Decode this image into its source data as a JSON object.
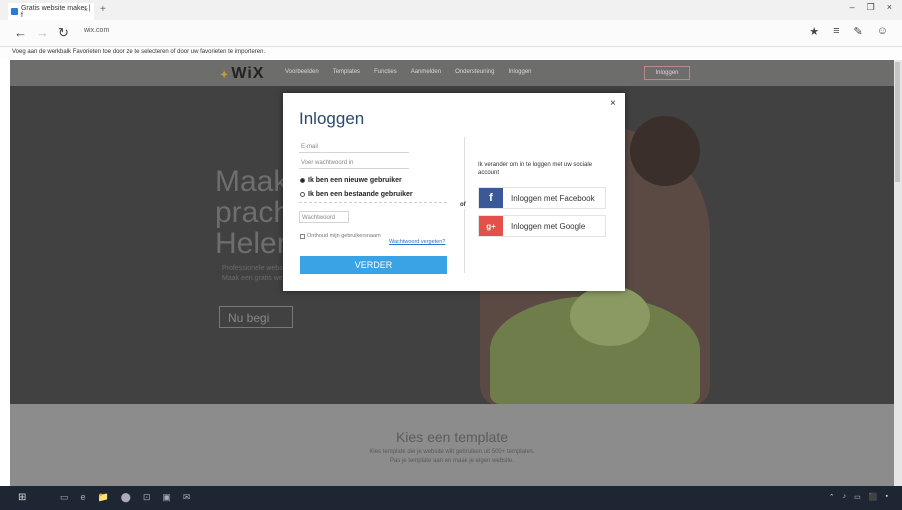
{
  "browser": {
    "tab_title": "Gratis website maker | f",
    "tab_close": "×",
    "new_tab": "+",
    "url": "wix.com",
    "back": "←",
    "forward": "→",
    "refresh": "↻",
    "favorites_bar_text": "Voeg aan de werkbalk Favorieten toe door ze te selecteren of door uw favorieten te importeren.",
    "window_controls": [
      "–",
      "❐",
      "×"
    ],
    "toolbar_icons": [
      "★",
      "≡",
      "✎",
      "☺"
    ]
  },
  "site": {
    "logo": "WiX",
    "nav": [
      "Voorbeelden",
      "Templates",
      "Functies",
      "Aanmelden",
      "Ondersteuning",
      "Inloggen"
    ],
    "nav_button": "Inloggen",
    "headline": [
      "Maak",
      "prach",
      "Helem"
    ],
    "hero_small": [
      "Professionele websites met",
      "Maak een gratis website"
    ],
    "hero_button": "Nu begi",
    "template_title": "Kies een template",
    "template_sub": [
      "Kies template die je website wilt gebruiken uit 500+ templates.",
      "Pas je template aan en maak je eigen website."
    ]
  },
  "modal": {
    "title": "Inloggen",
    "close": "×",
    "email_placeholder": "E-mail",
    "password_placeholder": "Voer wachtwoord in",
    "radio_new": "Ik ben een nieuwe gebruiker",
    "radio_existing": "Ik ben een bestaande gebruiker",
    "password2_placeholder": "Wachtwoord",
    "remember": "Onthoud mijn gebruikersnaam",
    "forgot": "Wachtwoord vergeten?",
    "submit": "VERDER",
    "or": "of",
    "social_intro": "Ik verander om in te loggen met uw sociale account",
    "facebook": "Inloggen met Facebook",
    "facebook_icon": "f",
    "google": "Inloggen met Google",
    "google_icon": "g+"
  },
  "taskbar": {
    "start": "⊞",
    "icons": [
      "▭",
      "e",
      "📁",
      "⬤",
      "⊡",
      "▣",
      "✉"
    ],
    "tray": [
      "⌃",
      "♪",
      "▭",
      "⬛",
      "▪"
    ]
  },
  "colors": {
    "accent": "#3aa3e6",
    "facebook": "#3b5998",
    "google": "#e4504a",
    "title": "#2b4a6a"
  }
}
